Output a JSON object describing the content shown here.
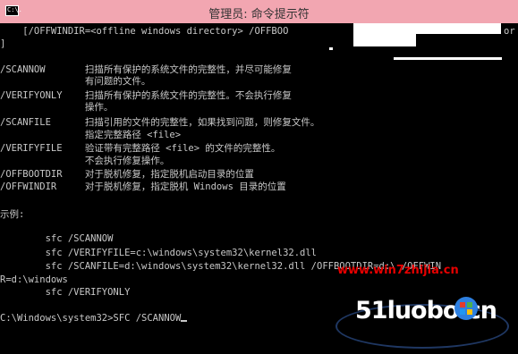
{
  "titlebar": {
    "title": "管理员: 命令提示符",
    "icon": "cmd-icon",
    "icon_text": "C:\\."
  },
  "console": {
    "lines": [
      "    [/OFFWINDIR=<offline windows directory> /OFFBOO",
      "]",
      "",
      "/SCANNOW       扫描所有保护的系统文件的完整性，并尽可能修复",
      "               有问题的文件。",
      "/VERIFYONLY    扫描所有保护的系统文件的完整性。不会执行修复",
      "               操作。",
      "/SCANFILE      扫描引用的文件的完整性，如果找到问题，则修复文件。",
      "               指定完整路径 <file>",
      "/VERIFYFILE    验证带有完整路径 <file> 的文件的完整性。",
      "               不会执行修复操作。",
      "/OFFBOOTDIR    对于脱机修复，指定脱机启动目录的位置",
      "/OFFWINDIR     对于脱机修复，指定脱机 Windows 目录的位置",
      "",
      "示例:",
      "",
      "        sfc /SCANNOW",
      "        sfc /VERIFYFILE=c:\\windows\\system32\\kernel32.dll",
      "        sfc /SCANFILE=d:\\windows\\system32\\kernel32.dll /OFFBOOTDIR=d:\\ /OFFWIN",
      "R=d:\\windows",
      "        sfc /VERIFYONLY",
      "",
      "C:\\Windows\\system32>SFC /SCANNOW"
    ],
    "line_1_tail": "or",
    "watermark_url": "www.win7zhijia.cn",
    "watermark_brand": "51luobo.cn",
    "colors": {
      "text": "#c8c8c8",
      "background": "#000000",
      "titlebar": "#f2a6b1",
      "watermark": "#e60000"
    }
  }
}
